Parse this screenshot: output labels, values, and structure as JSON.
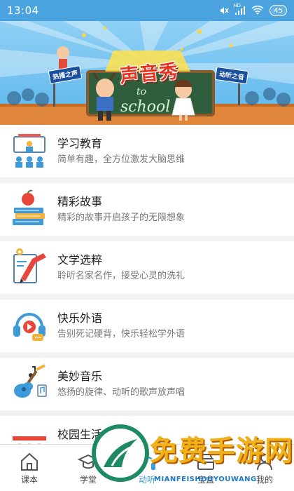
{
  "status_bar": {
    "time": "13:04",
    "network_label": "HD",
    "battery": "45"
  },
  "banner": {
    "title": "声音秀",
    "sign_left": "热播之声",
    "sign_right": "动听之音",
    "board_line1": "to",
    "board_line2": "school"
  },
  "list": {
    "items": [
      {
        "title": "学习教育",
        "desc": "简单有趣，全方位激发大脑思维",
        "icon": "classroom-icon"
      },
      {
        "title": "精彩故事",
        "desc": "精彩的故事开启孩子的无限想象",
        "icon": "apple-books-icon"
      },
      {
        "title": "文学选粹",
        "desc": "聆听名家名作，接受心灵的洗礼",
        "icon": "pen-paper-icon"
      },
      {
        "title": "快乐外语",
        "desc": "告别死记硬背，快乐轻松学外语",
        "icon": "headphones-icon"
      },
      {
        "title": "美妙音乐",
        "desc": "悠扬的旋律、动听的歌声放声唱",
        "icon": "guitar-icon"
      },
      {
        "title": "校园生活",
        "desc": "",
        "icon": "children-icon"
      }
    ]
  },
  "bottom_nav": {
    "tabs": [
      {
        "label": "课本",
        "icon": "home-icon"
      },
      {
        "label": "学堂",
        "icon": "graduation-cap-icon"
      },
      {
        "label": "动听",
        "icon": "headphones-nav-icon"
      },
      {
        "label": "宝盒",
        "icon": "treasure-box-icon"
      },
      {
        "label": "我的",
        "icon": "profile-icon"
      }
    ]
  },
  "watermark": {
    "text": "免费手游网",
    "subtext": "MIANFEISHOUYOUWANG"
  },
  "colors": {
    "status_bar": "#4aa3df",
    "accent": "#3e9ad8",
    "watermark_gold": "#f0b21a"
  }
}
